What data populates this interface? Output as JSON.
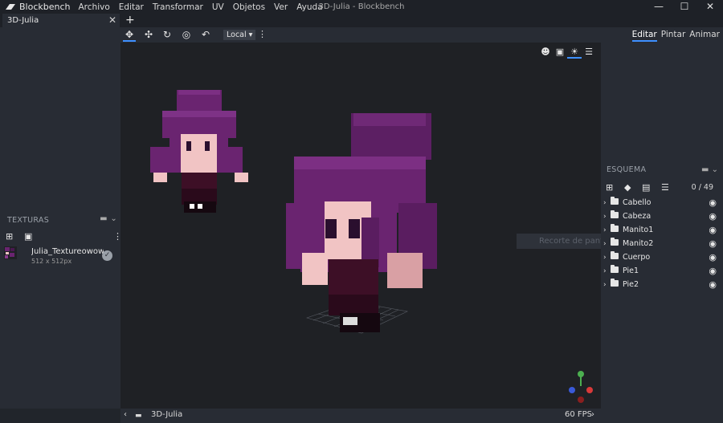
{
  "app": {
    "name": "Blockbench",
    "window_title": "3D-Julia - Blockbench",
    "menu": [
      "Archivo",
      "Editar",
      "Transformar",
      "UV",
      "Objetos",
      "Ver",
      "Ayuda"
    ]
  },
  "tabs": {
    "active": "3D-Julia",
    "add": "+"
  },
  "mode_tabs": [
    "Editar",
    "Pintar",
    "Animar"
  ],
  "toolbar": {
    "space": "Local ▾"
  },
  "textures": {
    "title": "TEXTURAS",
    "items": [
      {
        "name": "Julia_Textureowow.png",
        "size": "512 x 512px"
      }
    ]
  },
  "outliner": {
    "title": "ESQUEMA",
    "count": "0 / 49",
    "items": [
      "Cabello",
      "Cabeza",
      "Manito1",
      "Manito2",
      "Cuerpo",
      "Pie1",
      "Pie2"
    ]
  },
  "tooltip": "Recorte de pantalla",
  "status": {
    "model_name": "3D-Julia",
    "fps": "60 FPS"
  },
  "colors": {
    "accent": "#3e90ff",
    "hair": "#6a2470",
    "skin": "#f1c4c4"
  },
  "icons": [
    "blockbench-logo-icon",
    "move-icon",
    "resize-icon",
    "rotate-icon",
    "pivot-icon",
    "vertex-snap-icon",
    "sun-icon",
    "menu-icon",
    "eye-icon",
    "folder-icon"
  ]
}
